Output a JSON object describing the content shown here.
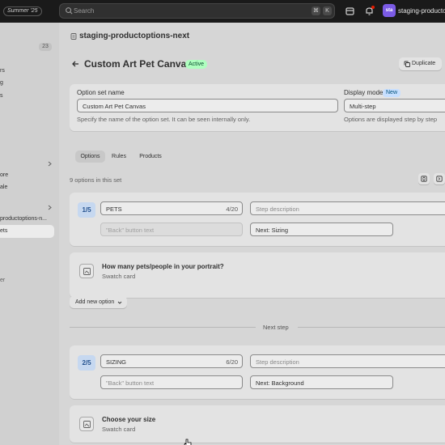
{
  "topbar": {
    "edition": "Summer '25",
    "search_placeholder": "Search",
    "shortcut_keys": [
      "⌘",
      "K"
    ],
    "avatar_initials": "sta",
    "store_name": "staging-productop"
  },
  "sidebar": {
    "badge": "23",
    "items": [
      "rs",
      "g",
      "s",
      "ore",
      "ale",
      "productoptions-n...",
      "ets",
      "er"
    ]
  },
  "page": {
    "breadcrumb": "staging-productoptions-next",
    "title": "Custom Art Pet Canvas",
    "status": "Active",
    "duplicate_label": "Duplicate"
  },
  "option_set": {
    "name_label": "Option set name",
    "name_value": "Custom Art Pet Canvas",
    "name_help": "Specify the name of the option set. It can be seen internally only.",
    "display_label": "Display mode",
    "display_badge": "New",
    "display_value": "Multi-step",
    "display_help": "Options are displayed step by step"
  },
  "tabs": [
    "Options",
    "Rules",
    "Products"
  ],
  "options_count": "9 options in this set",
  "steps": [
    {
      "number": "1/5",
      "title": "PETS",
      "title_count": "4/20",
      "description_placeholder": "Step description",
      "back_placeholder": "\"Back\" button text",
      "next_value": "Next: Sizing",
      "option_title": "How many pets/people in your portrait?",
      "option_type": "Swatch card"
    },
    {
      "number": "2/5",
      "title": "SIZING",
      "title_count": "6/20",
      "description_placeholder": "Step description",
      "back_placeholder": "\"Back\" button text",
      "next_value": "Next: Background",
      "option_title": "Choose your size",
      "option_type": "Swatch card"
    }
  ],
  "add_option_label": "Add new option",
  "next_step_label": "Next step"
}
